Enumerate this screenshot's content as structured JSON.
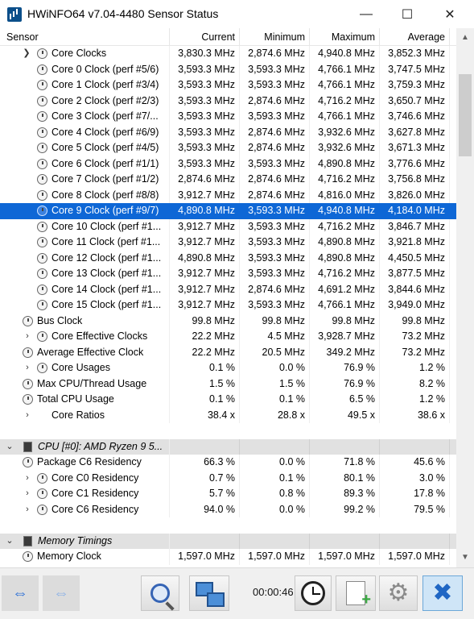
{
  "window": {
    "title": "HWiNFO64 v7.04-4480 Sensor Status",
    "min_glyph": "—",
    "max_glyph": "☐",
    "close_glyph": "✕"
  },
  "columns": {
    "sensor": "Sensor",
    "current": "Current",
    "minimum": "Minimum",
    "maximum": "Maximum",
    "average": "Average"
  },
  "rows": [
    {
      "name": "Core Clocks",
      "cur": "3,830.3 MHz",
      "min": "2,874.6 MHz",
      "max": "4,940.8 MHz",
      "avg": "3,852.3 MHz"
    },
    {
      "name": "Core 0 Clock (perf #5/6)",
      "cur": "3,593.3 MHz",
      "min": "3,593.3 MHz",
      "max": "4,766.1 MHz",
      "avg": "3,747.5 MHz"
    },
    {
      "name": "Core 1 Clock (perf #3/4)",
      "cur": "3,593.3 MHz",
      "min": "3,593.3 MHz",
      "max": "4,766.1 MHz",
      "avg": "3,759.3 MHz"
    },
    {
      "name": "Core 2 Clock (perf #2/3)",
      "cur": "3,593.3 MHz",
      "min": "2,874.6 MHz",
      "max": "4,716.2 MHz",
      "avg": "3,650.7 MHz"
    },
    {
      "name": "Core 3 Clock (perf #7/...",
      "cur": "3,593.3 MHz",
      "min": "3,593.3 MHz",
      "max": "4,766.1 MHz",
      "avg": "3,746.6 MHz"
    },
    {
      "name": "Core 4 Clock (perf #6/9)",
      "cur": "3,593.3 MHz",
      "min": "2,874.6 MHz",
      "max": "3,932.6 MHz",
      "avg": "3,627.8 MHz"
    },
    {
      "name": "Core 5 Clock (perf #4/5)",
      "cur": "3,593.3 MHz",
      "min": "2,874.6 MHz",
      "max": "3,932.6 MHz",
      "avg": "3,671.3 MHz"
    },
    {
      "name": "Core 6 Clock (perf #1/1)",
      "cur": "3,593.3 MHz",
      "min": "3,593.3 MHz",
      "max": "4,890.8 MHz",
      "avg": "3,776.6 MHz"
    },
    {
      "name": "Core 7 Clock (perf #1/2)",
      "cur": "2,874.6 MHz",
      "min": "2,874.6 MHz",
      "max": "4,716.2 MHz",
      "avg": "3,756.8 MHz"
    },
    {
      "name": "Core 8 Clock (perf #8/8)",
      "cur": "3,912.7 MHz",
      "min": "2,874.6 MHz",
      "max": "4,816.0 MHz",
      "avg": "3,826.0 MHz"
    },
    {
      "name": "Core 9 Clock (perf #9/7)",
      "cur": "4,890.8 MHz",
      "min": "3,593.3 MHz",
      "max": "4,940.8 MHz",
      "avg": "4,184.0 MHz"
    },
    {
      "name": "Core 10 Clock (perf #1...",
      "cur": "3,912.7 MHz",
      "min": "3,593.3 MHz",
      "max": "4,716.2 MHz",
      "avg": "3,846.7 MHz"
    },
    {
      "name": "Core 11 Clock (perf #1...",
      "cur": "3,912.7 MHz",
      "min": "3,593.3 MHz",
      "max": "4,890.8 MHz",
      "avg": "3,921.8 MHz"
    },
    {
      "name": "Core 12 Clock (perf #1...",
      "cur": "4,890.8 MHz",
      "min": "3,593.3 MHz",
      "max": "4,890.8 MHz",
      "avg": "4,450.5 MHz"
    },
    {
      "name": "Core 13 Clock (perf #1...",
      "cur": "3,912.7 MHz",
      "min": "3,593.3 MHz",
      "max": "4,716.2 MHz",
      "avg": "3,877.5 MHz"
    },
    {
      "name": "Core 14 Clock (perf #1...",
      "cur": "3,912.7 MHz",
      "min": "2,874.6 MHz",
      "max": "4,691.2 MHz",
      "avg": "3,844.6 MHz"
    },
    {
      "name": "Core 15 Clock (perf #1...",
      "cur": "3,912.7 MHz",
      "min": "3,593.3 MHz",
      "max": "4,766.1 MHz",
      "avg": "3,949.0 MHz"
    },
    {
      "name": "Bus Clock",
      "cur": "99.8 MHz",
      "min": "99.8 MHz",
      "max": "99.8 MHz",
      "avg": "99.8 MHz"
    },
    {
      "name": "Core Effective Clocks",
      "cur": "22.2 MHz",
      "min": "4.5 MHz",
      "max": "3,928.7 MHz",
      "avg": "73.2 MHz"
    },
    {
      "name": "Average Effective Clock",
      "cur": "22.2 MHz",
      "min": "20.5 MHz",
      "max": "349.2 MHz",
      "avg": "73.2 MHz"
    },
    {
      "name": "Core Usages",
      "cur": "0.1 %",
      "min": "0.0 %",
      "max": "76.9 %",
      "avg": "1.2 %"
    },
    {
      "name": "Max CPU/Thread Usage",
      "cur": "1.5 %",
      "min": "1.5 %",
      "max": "76.9 %",
      "avg": "8.2 %"
    },
    {
      "name": "Total CPU Usage",
      "cur": "0.1 %",
      "min": "0.1 %",
      "max": "6.5 %",
      "avg": "1.2 %"
    },
    {
      "name": "Core Ratios",
      "cur": "38.4 x",
      "min": "28.8 x",
      "max": "49.5 x",
      "avg": "38.6 x"
    },
    {
      "name": "CPU [#0]: AMD Ryzen 9 5...",
      "cur": "",
      "min": "",
      "max": "",
      "avg": ""
    },
    {
      "name": "Package C6 Residency",
      "cur": "66.3 %",
      "min": "0.0 %",
      "max": "71.8 %",
      "avg": "45.6 %"
    },
    {
      "name": "Core C0 Residency",
      "cur": "0.7 %",
      "min": "0.1 %",
      "max": "80.1 %",
      "avg": "3.0 %"
    },
    {
      "name": "Core C1 Residency",
      "cur": "5.7 %",
      "min": "0.8 %",
      "max": "89.3 %",
      "avg": "17.8 %"
    },
    {
      "name": "Core C6 Residency",
      "cur": "94.0 %",
      "min": "0.0 %",
      "max": "99.2 %",
      "avg": "79.5 %"
    },
    {
      "name": "Memory Timings",
      "cur": "",
      "min": "",
      "max": "",
      "avg": ""
    },
    {
      "name": "Memory Clock",
      "cur": "1,597.0 MHz",
      "min": "1,597.0 MHz",
      "max": "1,597.0 MHz",
      "avg": "1,597.0 MHz"
    }
  ],
  "toolbar": {
    "elapsed_time": "00:00:46"
  },
  "colors": {
    "selection": "#0e67d6",
    "group_header": "#e1e1e1",
    "close_accent": "#1f66c4"
  }
}
